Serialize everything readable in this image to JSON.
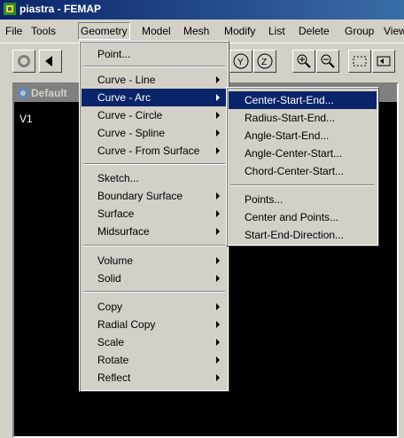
{
  "window": {
    "title": "piastra - FEMAP",
    "app_icon": "femap-app-icon"
  },
  "menubar": {
    "items": [
      "File",
      "Tools",
      "Geometry",
      "Model",
      "Mesh",
      "Modify",
      "List",
      "Delete",
      "Group",
      "View"
    ],
    "active": "Geometry"
  },
  "toolbar": {
    "buttons": [
      "rotate-icon",
      "prev-icon",
      "rotate-y-icon",
      "rotate-z-icon",
      "zoom-in-icon",
      "zoom-out-icon",
      "select-box-icon",
      "fit-icon"
    ]
  },
  "child_window": {
    "title": "Default",
    "view_label": "V1"
  },
  "geometry_menu": {
    "items": [
      {
        "label": "Point...",
        "submenu": false
      },
      {
        "label": "Curve - Line",
        "submenu": true
      },
      {
        "label": "Curve - Arc",
        "submenu": true,
        "highlighted": true
      },
      {
        "label": "Curve - Circle",
        "submenu": true
      },
      {
        "label": "Curve - Spline",
        "submenu": true
      },
      {
        "label": "Curve - From Surface",
        "submenu": true
      },
      {
        "label": "Sketch...",
        "submenu": false
      },
      {
        "label": "Boundary Surface",
        "submenu": true
      },
      {
        "label": "Surface",
        "submenu": true
      },
      {
        "label": "Midsurface",
        "submenu": true
      },
      {
        "label": "Volume",
        "submenu": true
      },
      {
        "label": "Solid",
        "submenu": true
      },
      {
        "label": "Copy",
        "submenu": true
      },
      {
        "label": "Radial Copy",
        "submenu": true
      },
      {
        "label": "Scale",
        "submenu": true
      },
      {
        "label": "Rotate",
        "submenu": true
      },
      {
        "label": "Reflect",
        "submenu": true
      }
    ]
  },
  "arc_submenu": {
    "items": [
      {
        "label": "Center-Start-End...",
        "highlighted": true
      },
      {
        "label": "Radius-Start-End..."
      },
      {
        "label": "Angle-Start-End..."
      },
      {
        "label": "Angle-Center-Start..."
      },
      {
        "label": "Chord-Center-Start..."
      },
      {
        "label": "Points..."
      },
      {
        "label": "Center and Points..."
      },
      {
        "label": "Start-End-Direction..."
      }
    ]
  }
}
